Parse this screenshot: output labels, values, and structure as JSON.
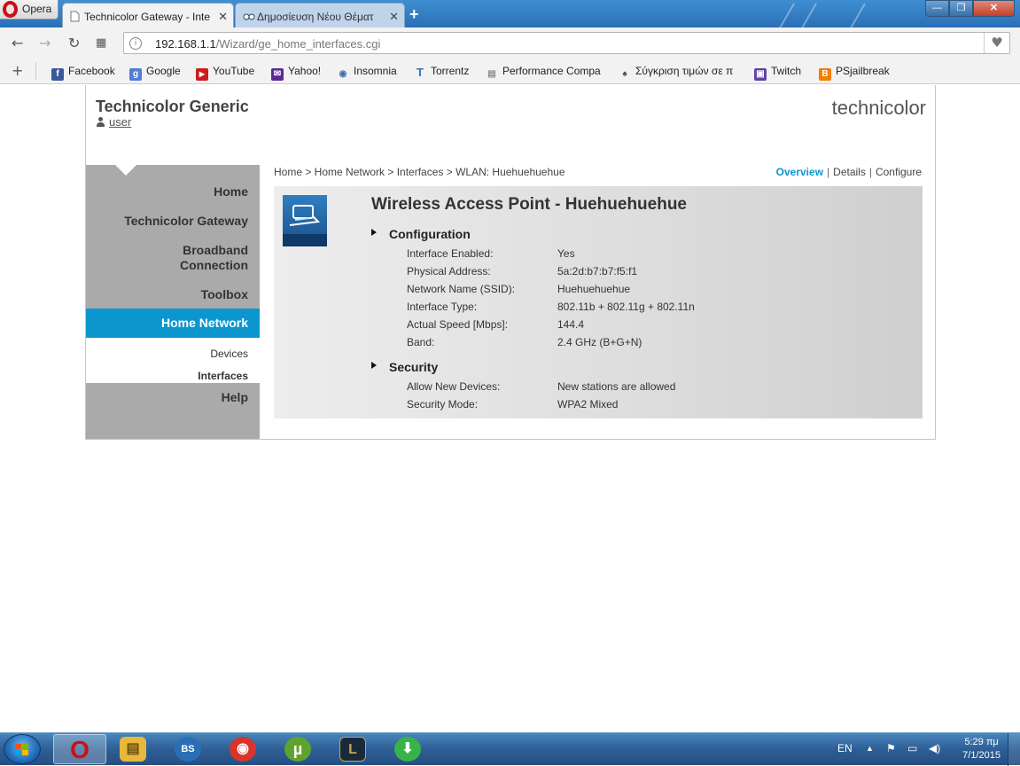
{
  "browser": {
    "menu_label": "Opera",
    "tabs": [
      {
        "title": "Technicolor Gateway - Inte",
        "active": true
      },
      {
        "title": "Δημοσίευση Νέου Θέματ",
        "active": false
      }
    ],
    "new_tab": "+",
    "window_buttons": {
      "minimize": "—",
      "maximize": "❐",
      "close": "✕"
    },
    "url_host": "192.168.1.1",
    "url_path": "/Wizard/ge_home_interfaces.cgi",
    "bookmarks": [
      {
        "label": "Facebook",
        "icon": "facebook-icon",
        "color": "#3b5998",
        "glyph": "f"
      },
      {
        "label": "Google",
        "icon": "google-icon",
        "color": "#4f7ed7",
        "glyph": "g"
      },
      {
        "label": "YouTube",
        "icon": "youtube-icon",
        "color": "#cc1b1b",
        "glyph": "▶"
      },
      {
        "label": "Yahoo!",
        "icon": "yahoo-mail-icon",
        "color": "#5b2a97",
        "glyph": "✉"
      },
      {
        "label": "Insomnia",
        "icon": "insomnia-icon",
        "color": "#3a6fb0",
        "glyph": "◉"
      },
      {
        "label": "Torrentz",
        "icon": "torrentz-icon",
        "color": "#3a6fb0",
        "glyph": "T"
      },
      {
        "label": "Performance Compa",
        "icon": "page-icon",
        "color": "#8c8c8c",
        "glyph": "▤"
      },
      {
        "label": "Σύγκριση τιμών σε π",
        "icon": "hat-icon",
        "color": "#444444",
        "glyph": "♠"
      },
      {
        "label": "Twitch",
        "icon": "twitch-icon",
        "color": "#6441a5",
        "glyph": "▣"
      },
      {
        "label": "PSjailbreak",
        "icon": "blogger-icon",
        "color": "#f57d00",
        "glyph": "B"
      }
    ]
  },
  "router": {
    "brand": "Technicolor Generic",
    "user": "user",
    "logo": "technicolor",
    "nav": {
      "home": "Home",
      "gateway": "Technicolor Gateway",
      "broadband_line1": "Broadband",
      "broadband_line2": "Connection",
      "toolbox": "Toolbox",
      "home_network": "Home Network",
      "devices": "Devices",
      "interfaces": "Interfaces",
      "help": "Help"
    },
    "breadcrumb": "Home > Home Network > Interfaces > WLAN: Huehuehuehue",
    "views": {
      "overview": "Overview",
      "details": "Details",
      "configure": "Configure",
      "separator": "|"
    },
    "title": "Wireless Access Point - Huehuehuehue",
    "configuration": {
      "heading": "Configuration",
      "rows": [
        {
          "label": "Interface Enabled:",
          "value": "Yes"
        },
        {
          "label": "Physical Address:",
          "value": "5a:2d:b7:b7:f5:f1"
        },
        {
          "label": "Network Name (SSID):",
          "value": "Huehuehuehue"
        },
        {
          "label": "Interface Type:",
          "value": "802.11b + 802.11g + 802.11n"
        },
        {
          "label": "Actual Speed [Mbps]:",
          "value": "144.4"
        },
        {
          "label": "Band:",
          "value": "2.4 GHz (B+G+N)"
        }
      ]
    },
    "security": {
      "heading": "Security",
      "rows": [
        {
          "label": "Allow New Devices:",
          "value": "New stations are allowed"
        },
        {
          "label": "Security Mode:",
          "value": "WPA2 Mixed"
        }
      ]
    },
    "accent_color": "#0b97ce"
  },
  "taskbar": {
    "language": "EN",
    "time": "5:29 πμ",
    "date": "7/1/2015",
    "apps": [
      {
        "name": "opera-taskbar-icon",
        "glyph": "O",
        "color": "#cc0f16",
        "active": true
      },
      {
        "name": "explorer-taskbar-icon",
        "glyph": "▤",
        "color": "#e7b83c",
        "active": false
      },
      {
        "name": "bluestacks-taskbar-icon",
        "glyph": "BS",
        "color": "#2a6fb5",
        "active": false
      },
      {
        "name": "recorder-taskbar-icon",
        "glyph": "◉",
        "color": "#d8342b",
        "active": false
      },
      {
        "name": "utorrent-taskbar-icon",
        "glyph": "µ",
        "color": "#5fa32f",
        "active": false
      },
      {
        "name": "league-taskbar-icon",
        "glyph": "L",
        "color": "#1b2a3a",
        "active": false
      },
      {
        "name": "download-taskbar-icon",
        "glyph": "⬇",
        "color": "#37b34a",
        "active": false
      }
    ]
  }
}
